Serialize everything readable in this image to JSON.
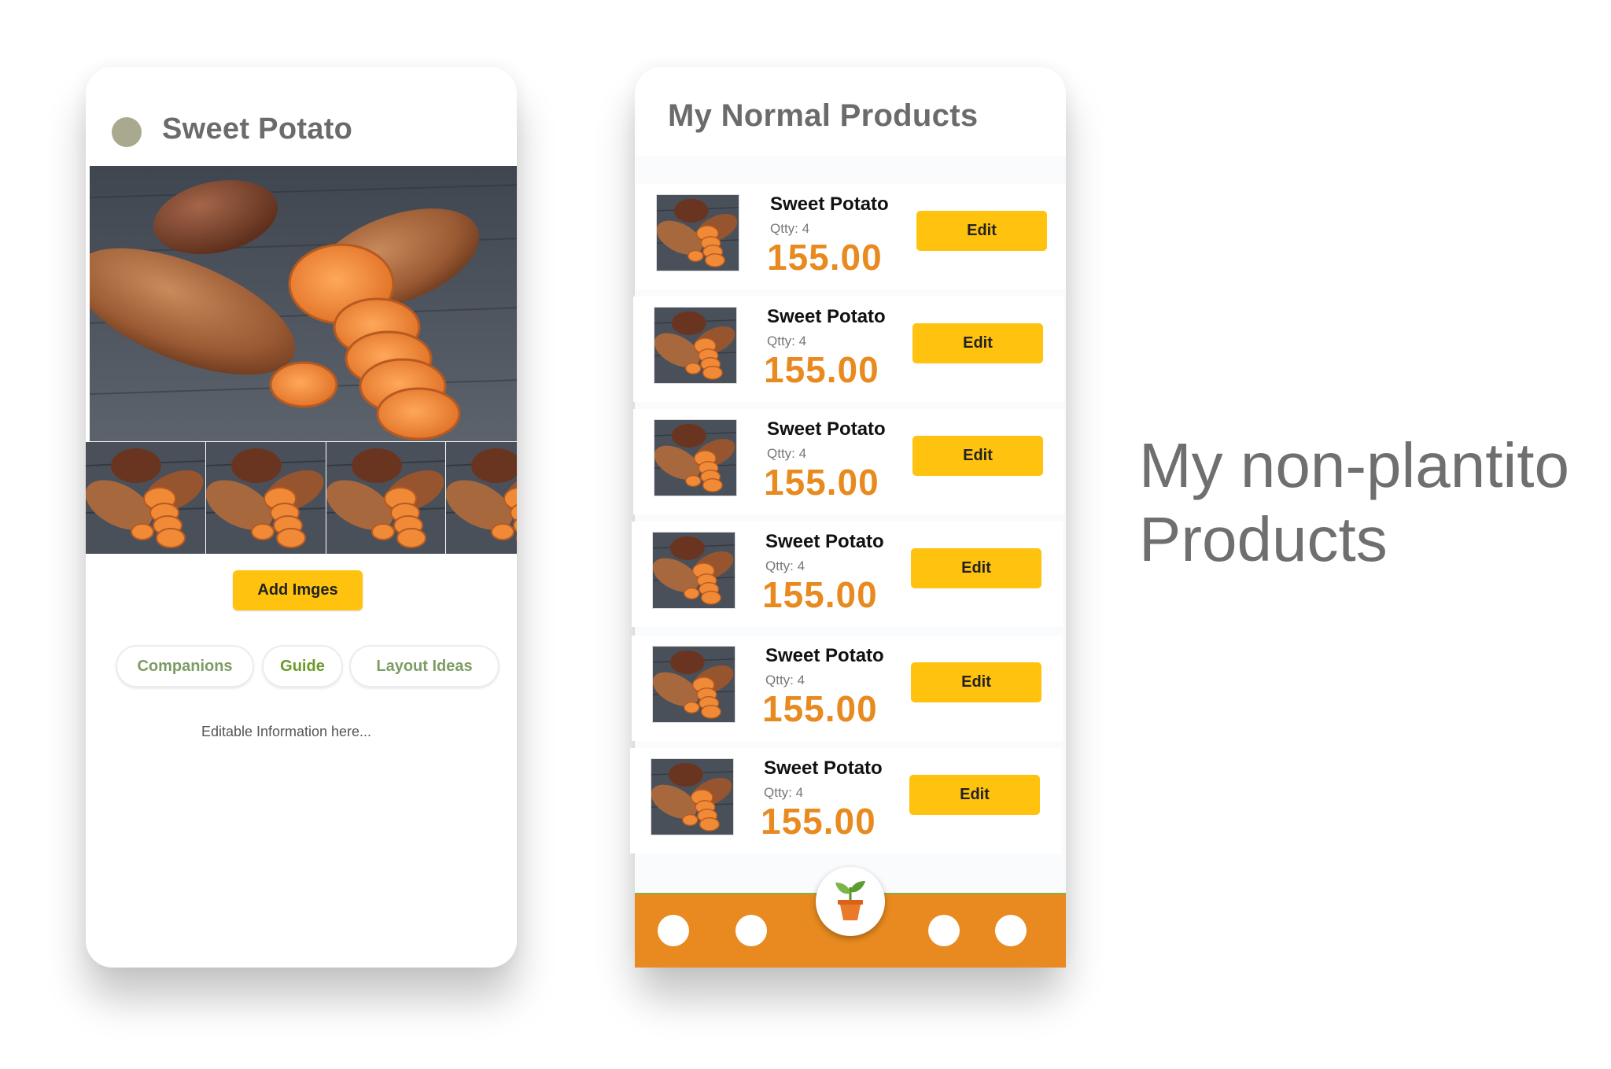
{
  "detail": {
    "title": "Sweet Potato",
    "add_images_label": "Add Imges",
    "tabs": [
      {
        "label": "Companions"
      },
      {
        "label": "Guide"
      },
      {
        "label": "Layout Ideas"
      }
    ],
    "editable_text": "Editable Information here...",
    "thumbnail_count": 4
  },
  "list": {
    "title": "My Normal Products",
    "items": [
      {
        "name": "Sweet Potato",
        "qty": "Qtty: 4",
        "price": "155.00",
        "edit_label": "Edit"
      },
      {
        "name": "Sweet Potato",
        "qty": "Qtty: 4",
        "price": "155.00",
        "edit_label": "Edit"
      },
      {
        "name": "Sweet Potato",
        "qty": "Qtty: 4",
        "price": "155.00",
        "edit_label": "Edit"
      },
      {
        "name": "Sweet Potato",
        "qty": "Qtty: 4",
        "price": "155.00",
        "edit_label": "Edit"
      },
      {
        "name": "Sweet Potato",
        "qty": "Qtty: 4",
        "price": "155.00",
        "edit_label": "Edit"
      },
      {
        "name": "Sweet Potato",
        "qty": "Qtty: 4",
        "price": "155.00",
        "edit_label": "Edit"
      }
    ],
    "nav": {
      "center_icon": "plant-pot-icon"
    }
  },
  "caption": {
    "line1": "My non-plantito",
    "line2": "Products"
  },
  "colors": {
    "accent": "#ffc20e",
    "price": "#e88a1f",
    "navbar": "#e88a20",
    "tab_text": "#7c9c64"
  }
}
